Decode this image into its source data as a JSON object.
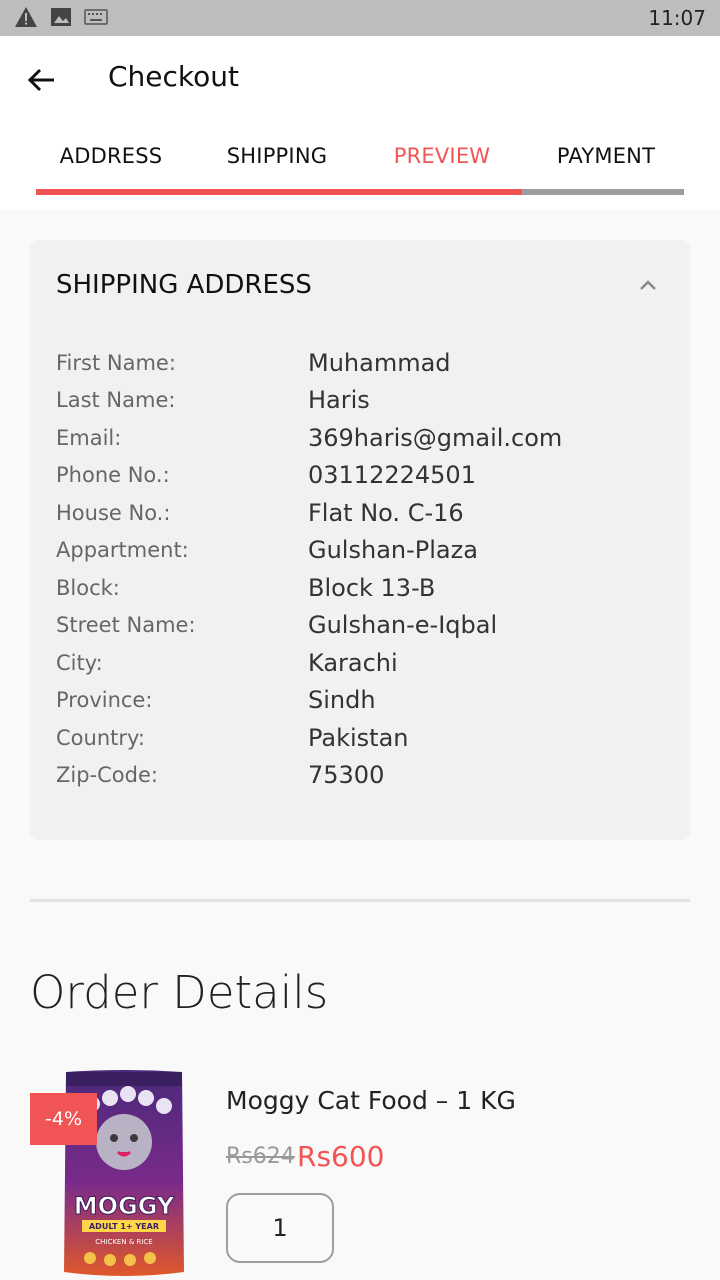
{
  "status_bar": {
    "time": "11:07",
    "icons": [
      "warning-icon",
      "image-icon",
      "keyboard-icon"
    ]
  },
  "header": {
    "title": "Checkout",
    "back_icon": "back-arrow-icon"
  },
  "steps": {
    "tabs": [
      {
        "label": "ADDRESS",
        "active": false
      },
      {
        "label": "SHIPPING",
        "active": false
      },
      {
        "label": "PREVIEW",
        "active": true
      },
      {
        "label": "PAYMENT",
        "active": false
      }
    ],
    "progress_fraction": 0.75
  },
  "shipping_address": {
    "title": "SHIPPING ADDRESS",
    "collapse_icon": "chevron-up-icon",
    "rows": [
      {
        "label": "First Name:",
        "value": "Muhammad"
      },
      {
        "label": "Last Name:",
        "value": "Haris"
      },
      {
        "label": "Email:",
        "value": "369haris@gmail.com"
      },
      {
        "label": "Phone No.:",
        "value": "03112224501"
      },
      {
        "label": "House No.:",
        "value": "Flat No. C-16"
      },
      {
        "label": "Appartment:",
        "value": "Gulshan-Plaza"
      },
      {
        "label": "Block:",
        "value": "Block 13-B"
      },
      {
        "label": "Street Name:",
        "value": "Gulshan-e-Iqbal"
      },
      {
        "label": "City:",
        "value": "Karachi"
      },
      {
        "label": "Province:",
        "value": "Sindh"
      },
      {
        "label": "Country:",
        "value": "Pakistan"
      },
      {
        "label": "Zip-Code:",
        "value": "75300"
      }
    ]
  },
  "order": {
    "title": "Order Details",
    "items": [
      {
        "name": "Moggy Cat Food – 1 KG",
        "discount": "-4%",
        "price_old": "Rs624",
        "price_new": "Rs600",
        "quantity": "1",
        "image_text": {
          "brand": "MOGGY",
          "variant": "ADULT 1+ YEAR",
          "flavor": "CHICKEN & RICE"
        }
      }
    ]
  },
  "colors": {
    "accent": "#f05454",
    "status_bar": "#bdbdbd",
    "card_bg": "#f0f1f3"
  }
}
